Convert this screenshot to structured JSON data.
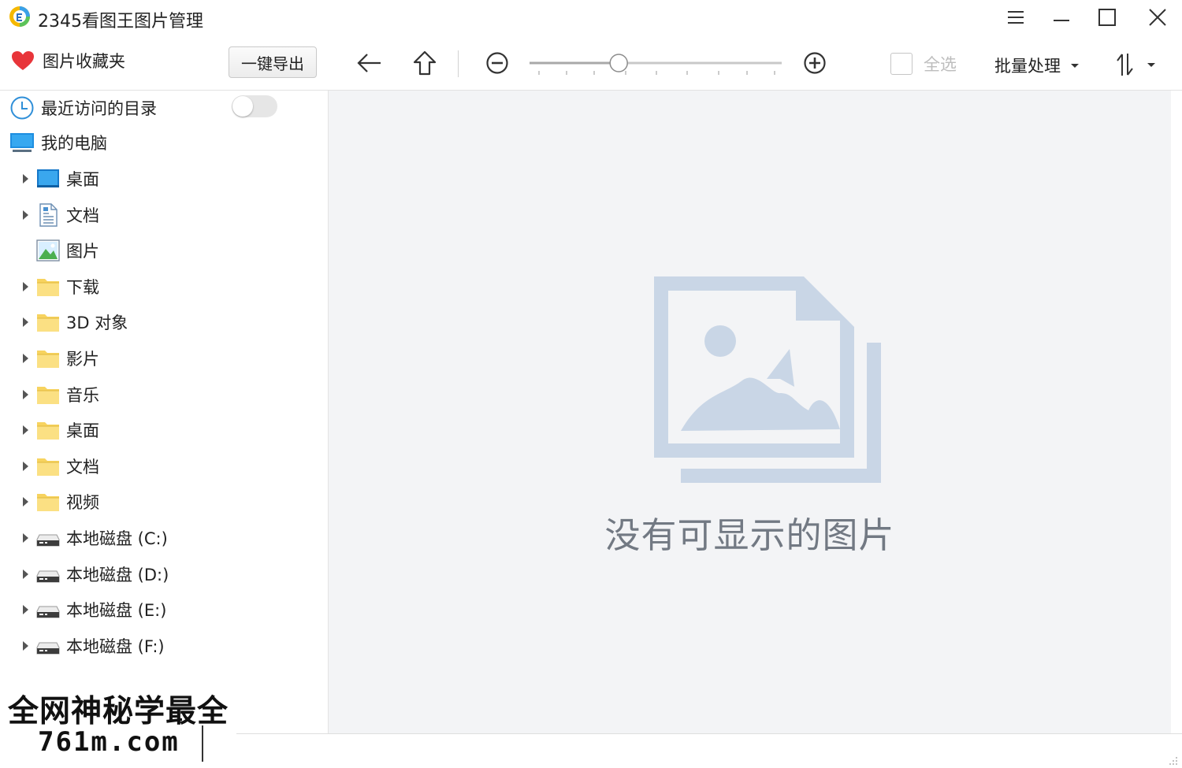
{
  "window": {
    "title": "2345看图王图片管理",
    "controls": [
      "menu-icon",
      "minimize-icon",
      "maximize-icon",
      "close-icon"
    ]
  },
  "toolbar": {
    "favorites_label": "图片收藏夹",
    "export_label": "一键导出",
    "select_all_label": "全选",
    "batch_label": "批量处理",
    "zoom_level": 0.35
  },
  "sidebar": {
    "recent_label": "最近访问的目录",
    "recent_toggle_on": false,
    "computer_label": "我的电脑",
    "items": [
      {
        "label": "桌面",
        "icon": "desktop-icon",
        "expandable": true
      },
      {
        "label": "文档",
        "icon": "document-icon",
        "expandable": true
      },
      {
        "label": "图片",
        "icon": "picture-icon",
        "expandable": false
      },
      {
        "label": "下载",
        "icon": "folder-icon",
        "expandable": true
      },
      {
        "label": "3D 对象",
        "icon": "folder-icon",
        "expandable": true
      },
      {
        "label": "影片",
        "icon": "folder-icon",
        "expandable": true
      },
      {
        "label": "音乐",
        "icon": "folder-icon",
        "expandable": true
      },
      {
        "label": "桌面",
        "icon": "folder-icon",
        "expandable": true
      },
      {
        "label": "文档",
        "icon": "folder-icon",
        "expandable": true
      },
      {
        "label": "视频",
        "icon": "folder-icon",
        "expandable": true
      },
      {
        "label": "本地磁盘 (C:)",
        "icon": "drive-icon",
        "expandable": true
      },
      {
        "label": "本地磁盘 (D:)",
        "icon": "drive-icon",
        "expandable": true
      },
      {
        "label": "本地磁盘 (E:)",
        "icon": "drive-icon",
        "expandable": true
      },
      {
        "label": "本地磁盘 (F:)",
        "icon": "drive-icon",
        "expandable": true
      }
    ]
  },
  "main": {
    "empty_message": "没有可显示的图片"
  },
  "watermark": {
    "line1": "全网神秘学最全",
    "line2": "761m.com"
  },
  "colors": {
    "accent": "#2f8fd8",
    "folder": "#f7d35f",
    "heart": "#e8353a",
    "empty_text": "#727983",
    "illustration": "#c9d6e6"
  }
}
